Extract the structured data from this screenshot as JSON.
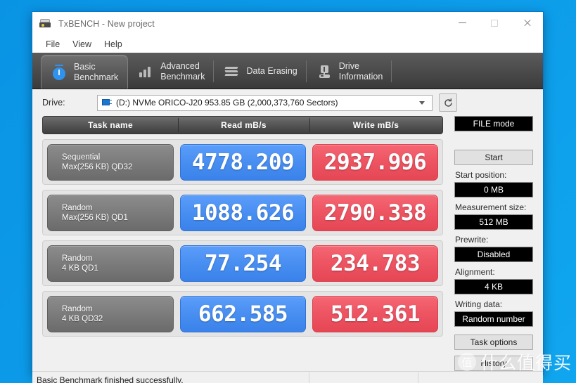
{
  "window": {
    "title": "TxBENCH - New project",
    "app_icon": "drive-app-icon",
    "controls": {
      "minimize": "—",
      "maximize": "□",
      "close": "✕"
    }
  },
  "menubar": {
    "items": [
      "File",
      "View",
      "Help"
    ]
  },
  "tabs": [
    {
      "label": "Basic\nBenchmark",
      "icon": "stopwatch-icon",
      "active": true
    },
    {
      "label": "Advanced\nBenchmark",
      "icon": "bar-chart-icon",
      "active": false
    },
    {
      "label": "Data Erasing",
      "icon": "shredder-icon",
      "active": false
    },
    {
      "label": "Drive\nInformation",
      "icon": "drive-info-icon",
      "active": false
    }
  ],
  "drive": {
    "label": "Drive:",
    "selected": "(D:) NVMe ORICO-J20  953.85 GB (2,000,373,760 Sectors)",
    "icon": "disk-drive-icon",
    "refresh_icon": "refresh-icon"
  },
  "table": {
    "headers": [
      "Task name",
      "Read mB/s",
      "Write mB/s"
    ],
    "rows": [
      {
        "task_line1": "Sequential",
        "task_line2": "Max(256 KB) QD32",
        "read": "4778.209",
        "write": "2937.996"
      },
      {
        "task_line1": "Random",
        "task_line2": "Max(256 KB) QD1",
        "read": "1088.626",
        "write": "2790.338"
      },
      {
        "task_line1": "Random",
        "task_line2": "4 KB QD1",
        "read": "77.254",
        "write": "234.783"
      },
      {
        "task_line1": "Random",
        "task_line2": "4 KB QD32",
        "read": "662.585",
        "write": "512.361"
      }
    ]
  },
  "panel": {
    "file_mode": "FILE mode",
    "start": "Start",
    "start_position_label": "Start position:",
    "start_position_value": "0 MB",
    "measurement_size_label": "Measurement size:",
    "measurement_size_value": "512 MB",
    "prewrite_label": "Prewrite:",
    "prewrite_value": "Disabled",
    "alignment_label": "Alignment:",
    "alignment_value": "4 KB",
    "writing_data_label": "Writing data:",
    "writing_data_value": "Random number",
    "task_options": "Task options",
    "history": "History"
  },
  "statusbar": {
    "message": "Basic Benchmark finished successfully."
  },
  "watermark": {
    "logo": "值",
    "text": "什么值得买"
  },
  "colors": {
    "desktop_blue": "#0c9ae8",
    "read_blue": "#4a90f2",
    "write_red": "#ee5563",
    "tab_dark": "#4a4a4a",
    "accent": "#2e93ef"
  }
}
